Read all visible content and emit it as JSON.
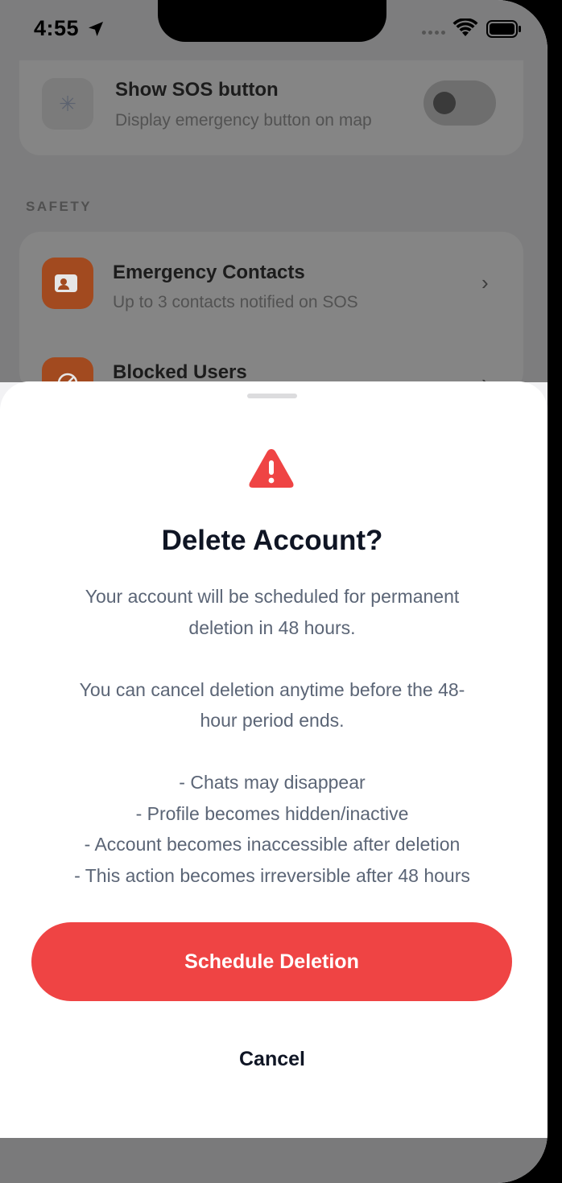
{
  "status_bar": {
    "time": "4:55",
    "icons": [
      "location-arrow-icon",
      "signal-icon",
      "wifi-icon",
      "battery-icon"
    ]
  },
  "background": {
    "sos_row": {
      "title": "Show SOS button",
      "subtitle": "Display emergency button on map",
      "icon": "asterisk-icon",
      "toggle_on": false
    },
    "section_label": "SAFETY",
    "safety_rows": [
      {
        "title": "Emergency Contacts",
        "subtitle": "Up to 3 contacts notified on SOS",
        "icon": "contact-card-icon",
        "icon_color": "#a24a1f"
      },
      {
        "title": "Blocked Users",
        "icon": "block-icon",
        "icon_color": "#a24a1f"
      }
    ]
  },
  "sheet": {
    "icon": "warning-triangle-icon",
    "accent": "#ef4444",
    "title": "Delete Account?",
    "paragraph1": [
      "Your account will be scheduled for permanent",
      "deletion in 48 hours."
    ],
    "paragraph2": [
      "You can cancel deletion anytime before the 48-",
      "hour period ends."
    ],
    "bullets": [
      "- Chats may disappear",
      "- Profile becomes hidden/inactive",
      "- Account becomes inaccessible after deletion",
      "- This action becomes irreversible after 48 hours"
    ],
    "primary_label": "Schedule Deletion",
    "cancel_label": "Cancel"
  }
}
